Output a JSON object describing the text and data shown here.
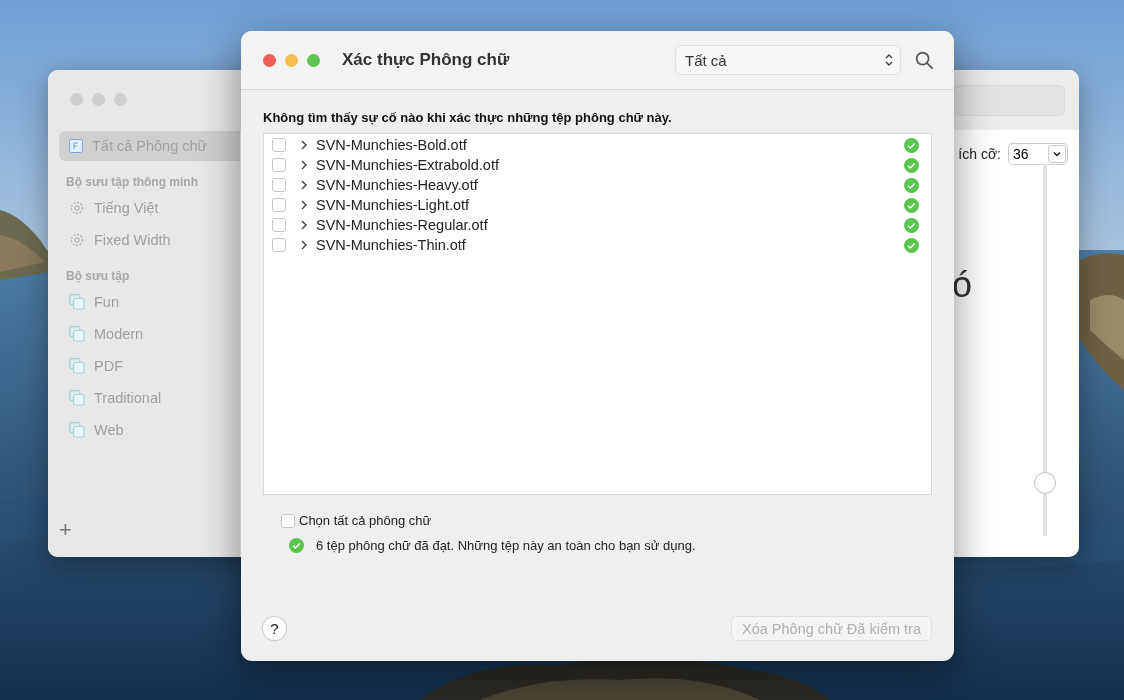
{
  "back_window": {
    "active": false,
    "sidebar": {
      "items": [
        {
          "label": "Tất cả Phông chữ",
          "kind": "library",
          "selected": true
        }
      ],
      "sections": [
        {
          "title": "Bộ sưu tập thông minh",
          "items": [
            {
              "label": "Tiếng Việt",
              "kind": "smart",
              "selected": false
            },
            {
              "label": "Fixed Width",
              "kind": "smart",
              "selected": false
            }
          ]
        },
        {
          "title": "Bộ sưu tập",
          "items": [
            {
              "label": "Fun",
              "kind": "collection",
              "selected": false
            },
            {
              "label": "Modern",
              "kind": "collection",
              "selected": false
            },
            {
              "label": "PDF",
              "kind": "collection",
              "selected": false
            },
            {
              "label": "Traditional",
              "kind": "collection",
              "selected": false
            },
            {
              "label": "Web",
              "kind": "collection",
              "selected": false
            }
          ]
        }
      ],
      "add_button": "+"
    },
    "size_label": "ích cỡ:",
    "size_value": "36",
    "size_slider": {
      "level": 0.12
    },
    "preview_glyph": "ó"
  },
  "dialog": {
    "title": "Xác thực Phông chữ",
    "filter": "Tất cả",
    "message": "Không tìm thấy sự cố nào khi xác thực những tệp phông chữ này.",
    "files": [
      {
        "name": "SVN-Munchies-Bold.otf",
        "checked": false,
        "expanded": false,
        "valid": true
      },
      {
        "name": "SVN-Munchies-Extrabold.otf",
        "checked": false,
        "expanded": false,
        "valid": true
      },
      {
        "name": "SVN-Munchies-Heavy.otf",
        "checked": false,
        "expanded": false,
        "valid": true
      },
      {
        "name": "SVN-Munchies-Light.otf",
        "checked": false,
        "expanded": false,
        "valid": true
      },
      {
        "name": "SVN-Munchies-Regular.otf",
        "checked": false,
        "expanded": false,
        "valid": true
      },
      {
        "name": "SVN-Munchies-Thin.otf",
        "checked": false,
        "expanded": false,
        "valid": true
      }
    ],
    "select_all": {
      "label": "Chọn tất cả phông chữ",
      "checked": false
    },
    "summary": {
      "text": "6 tệp phông chữ đã đạt. Những tệp này an toàn cho bạn sử dụng.",
      "valid": true
    },
    "help_button": "?",
    "remove_button": {
      "label": "Xóa Phông chữ Đã kiểm tra",
      "disabled": true
    }
  }
}
